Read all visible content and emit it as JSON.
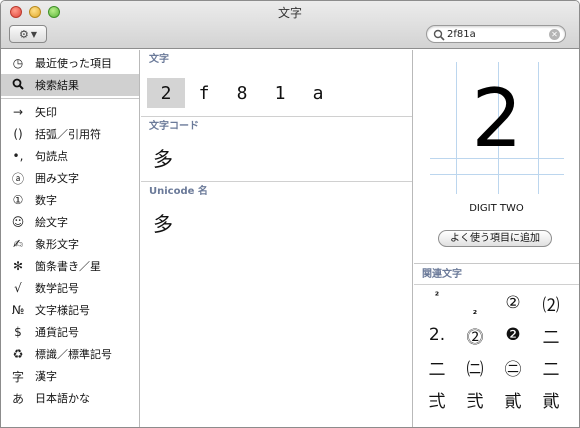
{
  "window": {
    "title": "文字"
  },
  "toolbar": {
    "action_icon": "gear-icon",
    "search_value": "2f81a"
  },
  "sidebar": {
    "items": [
      {
        "icon": "◷",
        "icon_name": "clock-icon",
        "label": "最近使った項目"
      },
      {
        "icon": "🔍",
        "icon_name": "magnifier-icon",
        "label": "検索結果",
        "selected": true
      },
      {
        "icon": "→",
        "icon_name": "arrow-icon",
        "label": "矢印"
      },
      {
        "icon": "()",
        "icon_name": "parentheses-icon",
        "label": "括弧／引用符"
      },
      {
        "icon": "•,",
        "icon_name": "punctuation-icon",
        "label": "句読点"
      },
      {
        "icon": "ⓐ",
        "icon_name": "circled-letter-icon",
        "label": "囲み文字"
      },
      {
        "icon": "①",
        "icon_name": "circled-digit-icon",
        "label": "数字"
      },
      {
        "icon": "☺",
        "icon_name": "smiley-icon",
        "label": "絵文字"
      },
      {
        "icon": "✍",
        "icon_name": "pictograph-icon",
        "label": "象形文字"
      },
      {
        "icon": "✻",
        "icon_name": "asterisk-icon",
        "label": "箇条書き／星"
      },
      {
        "icon": "√",
        "icon_name": "square-root-icon",
        "label": "数学記号"
      },
      {
        "icon": "№",
        "icon_name": "numero-icon",
        "label": "文字様記号"
      },
      {
        "icon": "$",
        "icon_name": "dollar-icon",
        "label": "通貨記号"
      },
      {
        "icon": "♻",
        "icon_name": "recycle-icon",
        "label": "標識／標準記号"
      },
      {
        "icon": "字",
        "icon_name": "kanji-icon",
        "label": "漢字"
      },
      {
        "icon": "あ",
        "icon_name": "hiragana-icon",
        "label": "日本語かな"
      }
    ]
  },
  "results": {
    "char_header": "文字",
    "chars": [
      "2",
      "f",
      "8",
      "1",
      "a"
    ],
    "code_header": "文字コード",
    "code_glyph": "多",
    "unicode_header": "Unicode 名",
    "unicode_glyph": "多"
  },
  "detail": {
    "preview_char": "2",
    "char_name": "DIGIT TWO",
    "add_favorites_label": "よく使う項目に追加",
    "related_header": "関連文字",
    "related": [
      "²",
      "₂",
      "②",
      "⑵",
      "2.",
      "⓶",
      "❷",
      "二",
      "二",
      "㈡",
      "㊁",
      "二",
      "弍",
      "弐",
      "貳",
      "貮"
    ]
  },
  "colors": {
    "accent_header": "#6b7a99",
    "selection": "#d0d0d0"
  }
}
